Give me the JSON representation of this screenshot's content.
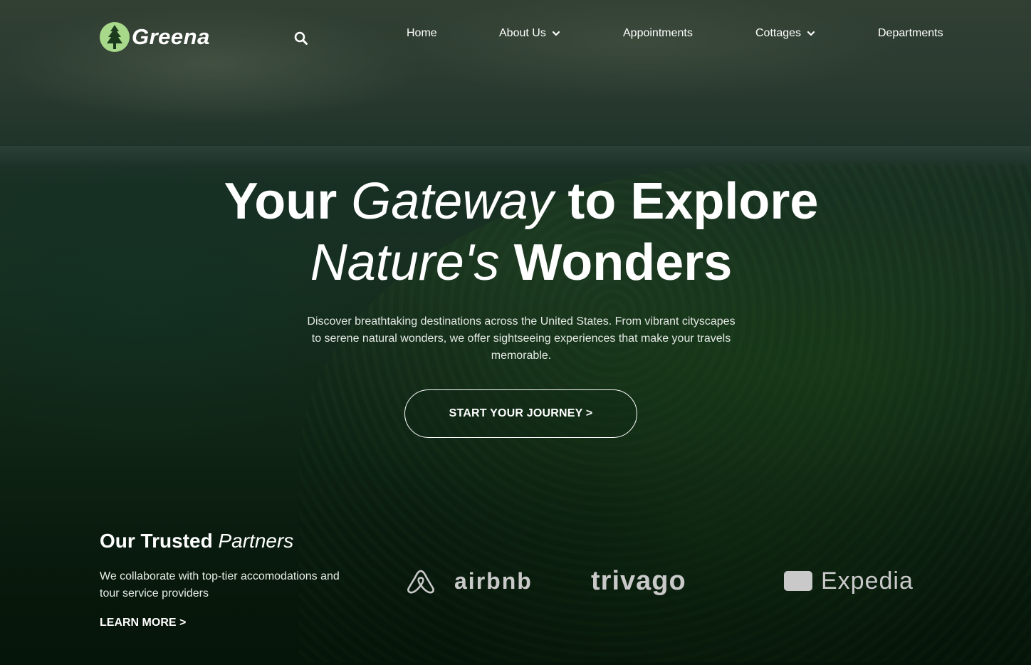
{
  "header": {
    "logo_text": "Greena",
    "nav": [
      {
        "label": "Home",
        "has_dropdown": false
      },
      {
        "label": "About Us",
        "has_dropdown": true
      },
      {
        "label": "Appointments",
        "has_dropdown": false
      },
      {
        "label": "Cottages",
        "has_dropdown": true
      },
      {
        "label": "Departments",
        "has_dropdown": false
      }
    ],
    "search_icon": "search-icon"
  },
  "hero": {
    "title_line1_part1": "Your ",
    "title_line1_italic": "Gateway",
    "title_line1_part2": " to Explore",
    "title_line2_italic": "Nature's",
    "title_line2_part2": " Wonders",
    "description": "Discover breathtaking destinations across the United States. From vibrant cityscapes to serene natural wonders, we offer sightseeing experiences that make your travels memorable.",
    "cta_label": "START YOUR JOURNEY >"
  },
  "partners": {
    "title_bold": "Our Trusted ",
    "title_italic": "Partners",
    "description": "We collaborate with top-tier accomodations and tour service providers",
    "learn_more_label": "LEARN MORE >",
    "logos": [
      "airbnb",
      "trivago",
      "Expedia"
    ]
  },
  "colors": {
    "logo_green": "#a8d88a",
    "partner_logo_gray": "#c9c9c9",
    "text": "#ffffff"
  }
}
